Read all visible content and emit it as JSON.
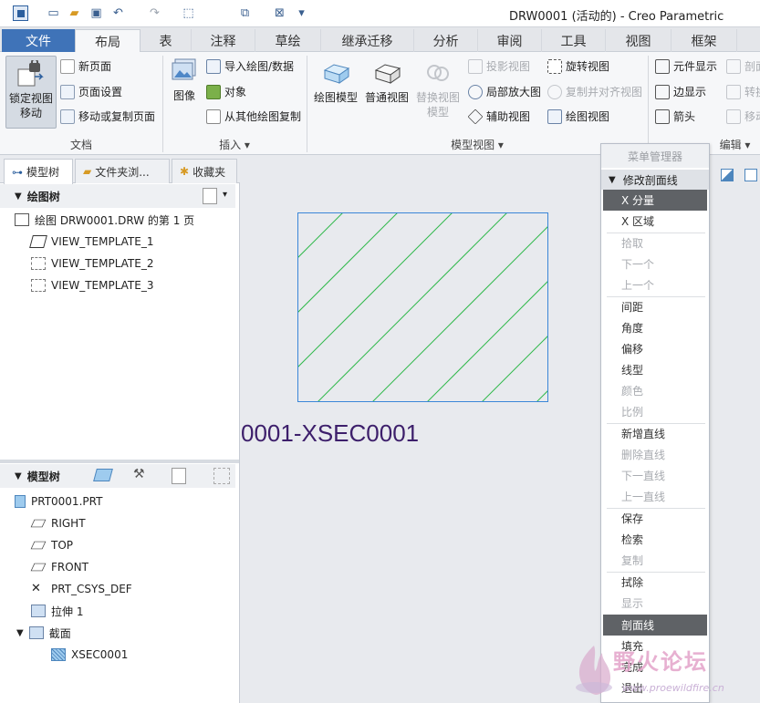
{
  "window": {
    "title": "DRW0001 (活动的) - Creo Parametric"
  },
  "tabs": [
    "文件",
    "布局",
    "表",
    "注释",
    "草绘",
    "继承迁移",
    "分析",
    "审阅",
    "工具",
    "视图",
    "框架"
  ],
  "ribbon": {
    "doc": {
      "lock_label": "锁定视图\n移动",
      "new_page": "新页面",
      "page_setup": "页面设置",
      "move_copy_page": "移动或复制页面",
      "group": "文档"
    },
    "insert": {
      "image": "图像",
      "import_drawing": "导入绘图/数据",
      "object": "对象",
      "copy_from_other": "从其他绘图复制",
      "group": "插入"
    },
    "model_views": {
      "drawing_model": "绘图模型",
      "general_view": "普通视图",
      "replace_model": "替换视图\n模型",
      "projection_view": "投影视图",
      "detail_view": "局部放大图",
      "auxiliary_view": "辅助视图",
      "revolved_view": "旋转视图",
      "copy_align_view": "复制并对齐视图",
      "drawing_view": "绘图视图",
      "group": "模型视图"
    },
    "edit": {
      "component_display": "元件显示",
      "section": "剖面",
      "edge_display": "边显示",
      "convert": "转换",
      "arrow": "箭头",
      "move": "移动",
      "group": "编辑"
    }
  },
  "left_panel": {
    "tabs": [
      "模型树",
      "文件夹浏...",
      "收藏夹"
    ],
    "drawing_tree": {
      "header": "绘图树",
      "items": [
        "绘图 DRW0001.DRW 的第 1 页",
        "VIEW_TEMPLATE_1",
        "VIEW_TEMPLATE_2",
        "VIEW_TEMPLATE_3"
      ]
    },
    "model_tree": {
      "header": "模型树",
      "items": [
        "PRT0001.PRT",
        "RIGHT",
        "TOP",
        "FRONT",
        "PRT_CSYS_DEF",
        "拉伸 1",
        "截面",
        "XSEC0001"
      ]
    }
  },
  "canvas": {
    "section_label": "0001-XSEC0001"
  },
  "menu_manager": {
    "title": "菜单管理器",
    "section_header": "修改剖面线",
    "items": [
      {
        "label": "X 分量",
        "state": "selected"
      },
      {
        "label": "X 区域",
        "state": "normal"
      },
      {
        "label": "拾取",
        "state": "disabled"
      },
      {
        "label": "下一个",
        "state": "disabled"
      },
      {
        "label": "上一个",
        "state": "disabled"
      },
      {
        "label": "间距",
        "state": "normal"
      },
      {
        "label": "角度",
        "state": "normal"
      },
      {
        "label": "偏移",
        "state": "normal"
      },
      {
        "label": "线型",
        "state": "normal"
      },
      {
        "label": "颜色",
        "state": "disabled"
      },
      {
        "label": "比例",
        "state": "disabled"
      },
      {
        "label": "新增直线",
        "state": "normal"
      },
      {
        "label": "删除直线",
        "state": "disabled"
      },
      {
        "label": "下一直线",
        "state": "disabled"
      },
      {
        "label": "上一直线",
        "state": "disabled"
      },
      {
        "label": "保存",
        "state": "normal"
      },
      {
        "label": "检索",
        "state": "normal"
      },
      {
        "label": "复制",
        "state": "disabled"
      },
      {
        "label": "拭除",
        "state": "normal"
      },
      {
        "label": "显示",
        "state": "disabled"
      },
      {
        "label": "剖面线",
        "state": "selected"
      },
      {
        "label": "填充",
        "state": "normal"
      },
      {
        "label": "完成",
        "state": "normal"
      },
      {
        "label": "退出",
        "state": "normal"
      }
    ]
  },
  "watermark": {
    "name": "野火论坛",
    "url": "www.proewildfire.cn"
  },
  "colors": {
    "file_tab": "#3f73b8",
    "hatch_border": "#3a86d8",
    "hatch_lines": "#2fb84a",
    "section_label": "#3d1f6b",
    "menu_selected": "#5f6266"
  }
}
